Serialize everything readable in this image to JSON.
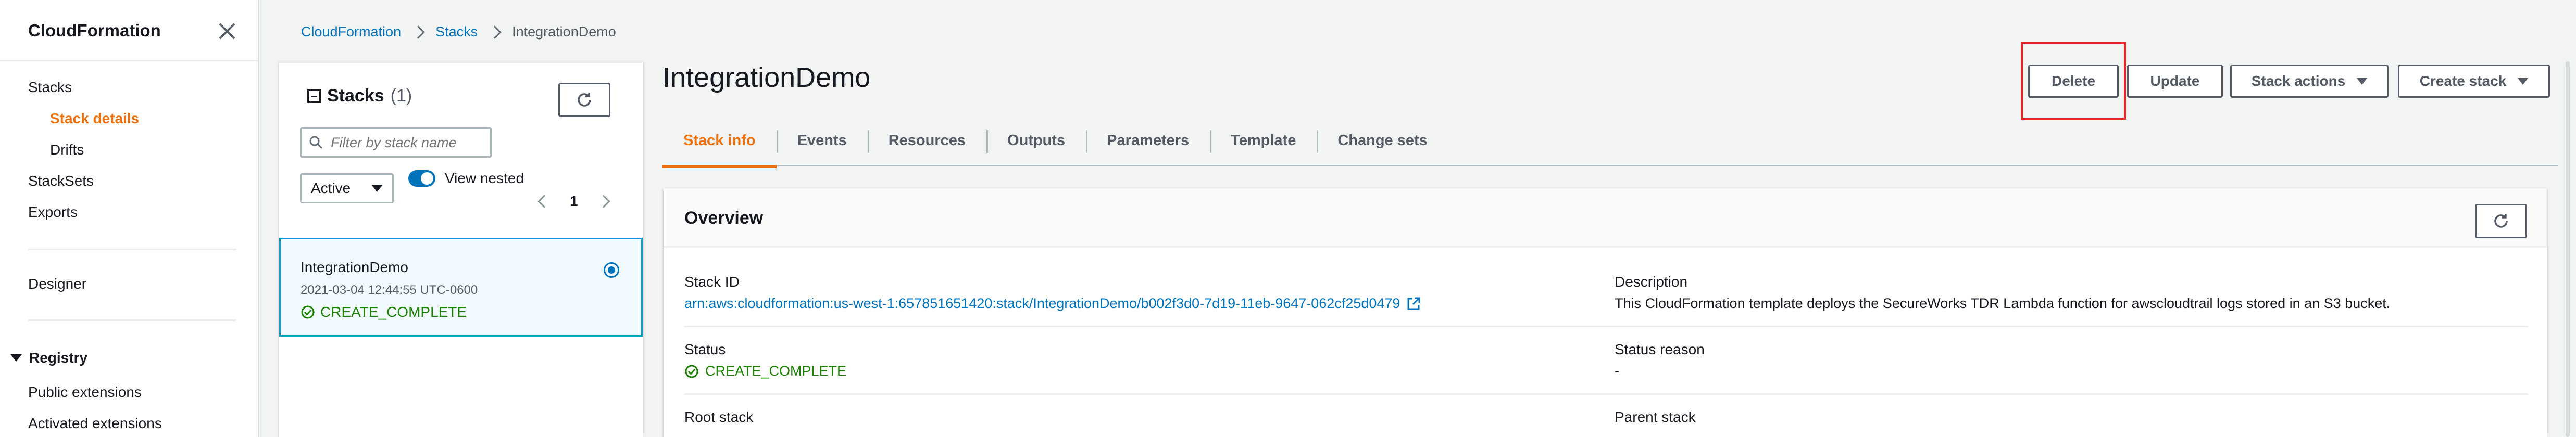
{
  "sidenav": {
    "title": "CloudFormation",
    "items": [
      {
        "label": "Stacks"
      },
      {
        "label": "Stack details"
      },
      {
        "label": "Drifts"
      },
      {
        "label": "StackSets"
      },
      {
        "label": "Exports"
      },
      {
        "label": "Designer"
      },
      {
        "label": "Public extensions"
      },
      {
        "label": "Activated extensions"
      }
    ],
    "registry_label": "Registry"
  },
  "breadcrumb": [
    "CloudFormation",
    "Stacks",
    "IntegrationDemo"
  ],
  "stacks_panel": {
    "title": "Stacks",
    "count": "(1)",
    "filter_placeholder": "Filter by stack name",
    "status_filter": "Active",
    "view_nested_label": "View nested",
    "view_nested_on": true,
    "page": "1",
    "stack": {
      "name": "IntegrationDemo",
      "created": "2021-03-04 12:44:55 UTC-0600",
      "status": "CREATE_COMPLETE"
    }
  },
  "main": {
    "title": "IntegrationDemo",
    "buttons": {
      "delete": "Delete",
      "update": "Update",
      "stack_actions": "Stack actions",
      "create_stack": "Create stack"
    },
    "tabs": [
      "Stack info",
      "Events",
      "Resources",
      "Outputs",
      "Parameters",
      "Template",
      "Change sets"
    ],
    "overview": {
      "title": "Overview",
      "stack_id_label": "Stack ID",
      "stack_id": "arn:aws:cloudformation:us-west-1:657851651420:stack/IntegrationDemo/b002f3d0-7d19-11eb-9647-062cf25d0479",
      "description_label": "Description",
      "description": "This CloudFormation template deploys the SecureWorks TDR Lambda function for awscloudtrail logs stored in an S3 bucket.",
      "status_label": "Status",
      "status": "CREATE_COMPLETE",
      "status_reason_label": "Status reason",
      "status_reason": "-",
      "root_stack_label": "Root stack",
      "parent_stack_label": "Parent stack"
    }
  },
  "colors": {
    "accent": "#ec7211",
    "link": "#0073bb",
    "success": "#1d8102",
    "highlight": "#e4272b"
  }
}
